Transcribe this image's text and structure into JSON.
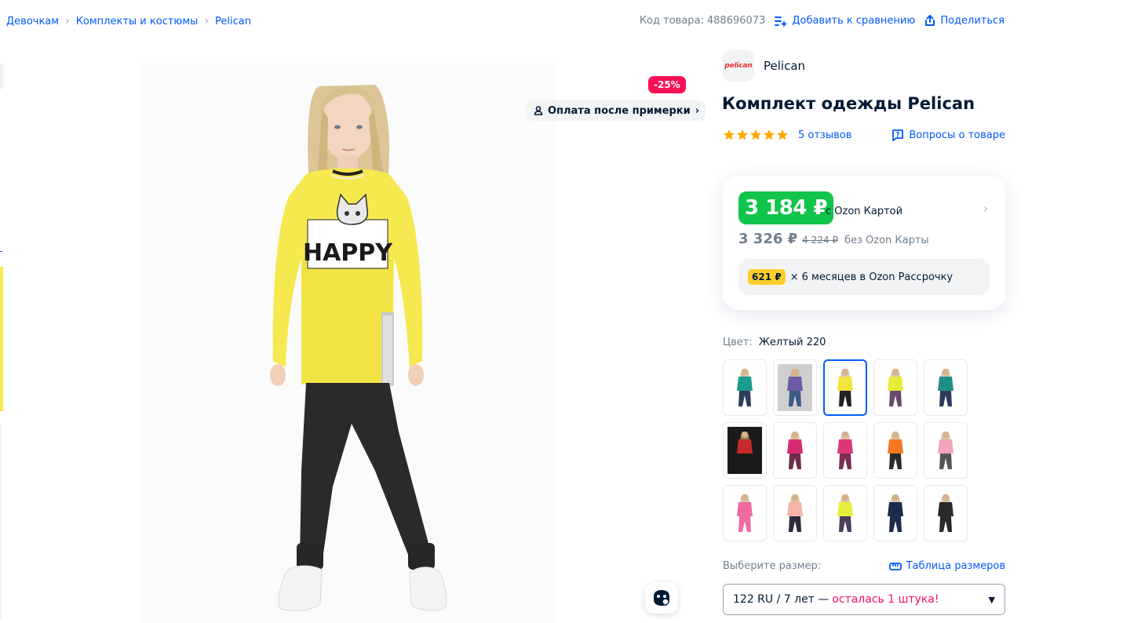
{
  "breadcrumb": [
    "Девочкам",
    "Комплекты и костюмы",
    "Pelican"
  ],
  "top_bar": {
    "sku_label": "Код товара:",
    "sku_value": "488696073",
    "compare_label": "Добавить к сравнению",
    "share_label": "Поделиться"
  },
  "gallery": {
    "discount_badge": "-25%",
    "try_pay_label": "Оплата после примерки",
    "shirt_print": "HAPPY"
  },
  "brand": {
    "logo_text": "pelican",
    "name": "Pelican"
  },
  "title": "Комплект одежды Pelican",
  "rating": {
    "stars": 5,
    "reviews_label": "5 отзывов",
    "questions_label": "Вопросы о товаре"
  },
  "price": {
    "card_price": "3 184 ₽",
    "card_label": "с Ozon Картой",
    "regular_price": "3 326 ₽",
    "old_price": "4 224 ₽",
    "regular_label": "без Ozon Карты",
    "installment_amount": "621 ₽",
    "installment_text": "× 6 месяцев в Ozon Рассрочку"
  },
  "color": {
    "label": "Цвет:",
    "value": "Желтый 220",
    "swatches": [
      {
        "top": "#1a9d8a",
        "bottom": "#2f3d5c",
        "selected": false
      },
      {
        "top": "#6f5aa8",
        "bottom": "#3d5b86",
        "selected": false,
        "photo_bg": "#cfcfcf"
      },
      {
        "top": "#f2e43a",
        "bottom": "#222222",
        "selected": true
      },
      {
        "top": "#e4ec3b",
        "bottom": "#6b4a6e",
        "selected": false
      },
      {
        "top": "#1f8f86",
        "bottom": "#2e3b58",
        "selected": false
      },
      {
        "top": "#c62a2a",
        "bottom": "#1a1a1a",
        "selected": false,
        "photo_bg": "#1a1a1a"
      },
      {
        "top": "#d82a74",
        "bottom": "#6e2b4a",
        "selected": false
      },
      {
        "top": "#e03779",
        "bottom": "#7a2d55",
        "selected": false
      },
      {
        "top": "#f37a22",
        "bottom": "#2a2a2a",
        "selected": false
      },
      {
        "top": "#f3a5b9",
        "bottom": "#555555",
        "selected": false
      },
      {
        "top": "#f06aa5",
        "bottom": "#f06aa5",
        "selected": false
      },
      {
        "top": "#f6b3a8",
        "bottom": "#2b2b3b",
        "selected": false
      },
      {
        "top": "#e6ef3c",
        "bottom": "#4b3f5c",
        "selected": false
      },
      {
        "top": "#1c2a4c",
        "bottom": "#1c2a4c",
        "selected": false
      },
      {
        "top": "#2a2a2a",
        "bottom": "#2a2a2a",
        "selected": false
      }
    ]
  },
  "size": {
    "label": "Выберите размер:",
    "table_label": "Таблица размеров",
    "selected_value": "122 RU / 7 лет —",
    "stock_note": "осталась 1 штука!"
  },
  "colors": {
    "accent": "#005bff",
    "price_green": "#10c44c",
    "discount_red": "#f91155",
    "star_yellow": "#ffa800",
    "installment_yellow": "#ffcf2c"
  }
}
